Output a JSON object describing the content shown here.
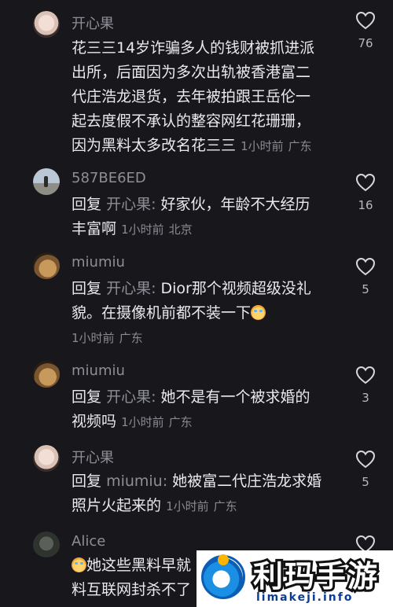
{
  "comments": [
    {
      "user": "开心果",
      "lines": [
        "花三三14岁诈骗多人的钱财被抓进派",
        "出所，后面因为多次出轨被香港富二",
        "代庄浩龙退货，去年被拍跟王岳伦一",
        "起去度假不承认的整容网红花珊珊，",
        "因为黑料太多改名花三三"
      ],
      "time": "1小时前",
      "location": "广东",
      "likes": "76"
    },
    {
      "user": "587BE6ED",
      "reply_prefix": "回复",
      "reply_to": "开心果:",
      "lines": [
        "好家伙，年龄不大经历",
        "丰富啊"
      ],
      "time": "1小时前",
      "location": "北京",
      "likes": "16"
    },
    {
      "user": "miumiu",
      "reply_prefix": "回复",
      "reply_to": "开心果:",
      "lines": [
        "Dior那个视频超级没礼",
        "貌。在摄像机前都不装一下"
      ],
      "time": "1小时前",
      "location": "广东",
      "likes": "5"
    },
    {
      "user": "miumiu",
      "reply_prefix": "回复",
      "reply_to": "开心果:",
      "lines": [
        "她不是有一个被求婚的",
        "视频吗"
      ],
      "time": "1小时前",
      "location": "广东",
      "likes": "3"
    },
    {
      "user": "开心果",
      "reply_prefix": "回复",
      "reply_to": "miumiu:",
      "lines": [
        "她被富二代庄浩龙求婚",
        "照片火起来的"
      ],
      "time": "1小时前",
      "location": "广东",
      "likes": "5"
    },
    {
      "user": "Alice",
      "lines": [
        "她这些黑料早就",
        "料互联网封杀不了"
      ]
    }
  ],
  "watermark": {
    "title": "利玛手游",
    "url": "limakeji.info"
  },
  "colors": {
    "background": "#17171c",
    "text": "#e9e9ee",
    "muted": "#8e8e96",
    "brand_blue": "#0b5db5"
  },
  "icons": [
    "heart-outline-icon",
    "crying-emoji-icon"
  ]
}
